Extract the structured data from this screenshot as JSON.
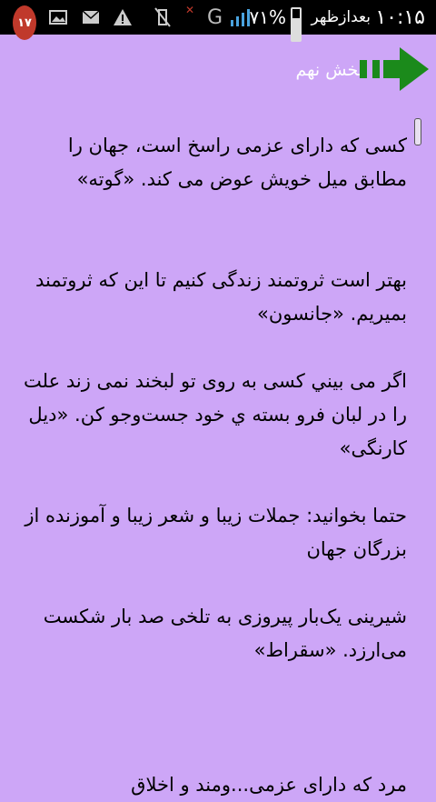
{
  "status_bar": {
    "notification_count": "۱۷",
    "battery_percent": "۷۱%",
    "time_prefix": "بعدازظهر",
    "clock": "۱۰:۱۵",
    "network": "G",
    "battery_level": 0.71,
    "icons": [
      "notification-badge",
      "image-icon",
      "mail-icon",
      "warning-icon",
      "mute-icon",
      "signal-icon",
      "battery-icon"
    ]
  },
  "header": {
    "title": "بخش نهم",
    "accent_color": "#1b8a1b"
  },
  "content": {
    "paragraphs": [
      "کسی که دارای عزمی راسخ است، جهان را مطابق میل خویش عوض می کند. «گوته»",
      "بهتر است ثروتمند زندگی کنیم تا این که ثروتمند بمیریم. «جانسون»",
      "اگر می بيني کسی به روی تو لبخند نمی زند علت را در لبان فرو بسته ي خود جست‌وجو کن. «دیل کارنگی»",
      "حتما بخوانید: جملات زیبا و شعر زیبا و آموزنده از بزرگان جهان",
      "شیرینی یک‌بار پیروزی به تلخی صد بار شکست می‌ارزد. «سقراط»",
      "مرد که دارای عزمی...ومند و اخلاق"
    ]
  }
}
